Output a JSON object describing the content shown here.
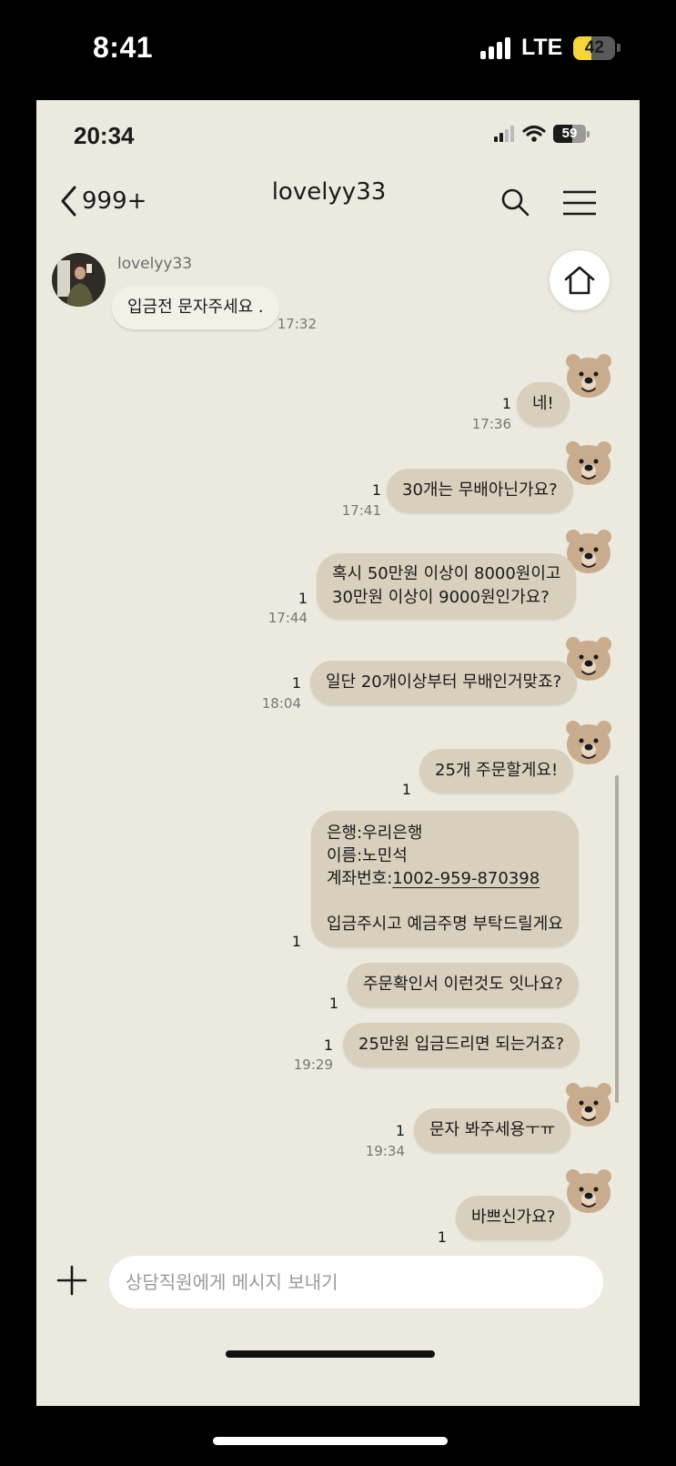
{
  "outer_status": {
    "time": "8:41",
    "network": "LTE",
    "battery": "42",
    "battery_level": 0.42
  },
  "inner_status": {
    "time": "20:34",
    "battery": "59",
    "battery_level": 0.59
  },
  "header": {
    "back_count": "999+",
    "title": "lovelyy33"
  },
  "contact": {
    "name": "lovelyy33"
  },
  "messages": [
    {
      "from": "them",
      "text": "입금전 문자주세요 .",
      "time": "17:32"
    },
    {
      "from": "me",
      "text": "네!",
      "unread": "1",
      "time": "17:36"
    },
    {
      "from": "me",
      "text": "30개는 무배아닌가요?",
      "unread": "1",
      "time": "17:41"
    },
    {
      "from": "me",
      "lines": [
        "혹시 50만원 이상이 8000원이고",
        "30만원 이상이 9000원인가요?"
      ],
      "unread": "1",
      "time": "17:44"
    },
    {
      "from": "me",
      "text": "일단 20개이상부터 무배인거맞죠?",
      "unread": "1",
      "time": "18:04"
    },
    {
      "from": "me",
      "text": "25개 주문할게요!",
      "unread": "1"
    },
    {
      "from": "me",
      "lines": [
        "은행:우리은행",
        "이름:노민석",
        "계좌번호:",
        "1002-959-870398",
        "입금주시고 예금주명 부탁드릴게요"
      ],
      "unread": "1"
    },
    {
      "from": "me",
      "text": "주문확인서 이런것도 잇나요?",
      "unread": "1"
    },
    {
      "from": "me",
      "text": "25만원 입금드리면 되는거죠?",
      "unread": "1",
      "time": "19:29"
    },
    {
      "from": "me",
      "text": "문자 봐주세용ㅜㅠ",
      "unread": "1",
      "time": "19:34"
    },
    {
      "from": "me",
      "text": "바쁘신가요?",
      "unread": "1"
    }
  ],
  "input": {
    "placeholder": "상담직원에게 메시지 보내기"
  },
  "colors": {
    "my_bubble": "#d8cfbd",
    "their_bubble": "#f3f0e8",
    "background": "#ece9df",
    "bear": "#c9ab8e"
  },
  "icons": [
    "back-chevron-icon",
    "search-icon",
    "menu-icon",
    "home-icon",
    "bear-avatar-icon",
    "plus-icon",
    "wifi-icon"
  ]
}
